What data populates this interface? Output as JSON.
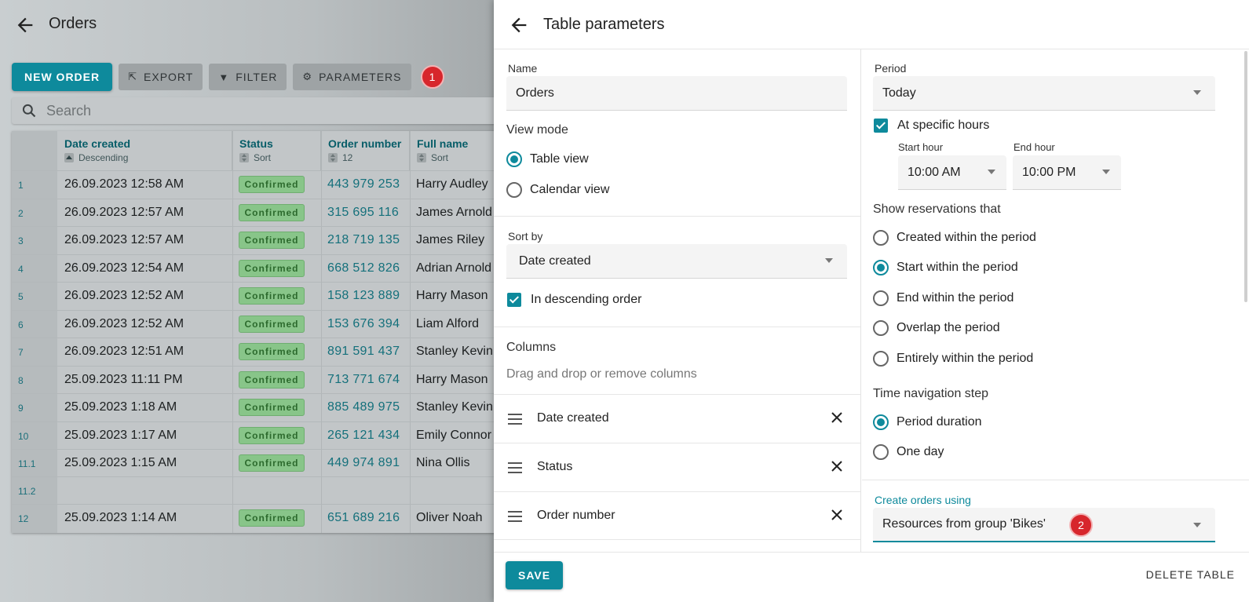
{
  "background": {
    "title": "Orders",
    "toolbar": {
      "new_order": "NEW ORDER",
      "export": "EXPORT",
      "filter": "FILTER",
      "parameters": "PARAMETERS",
      "badge": "1"
    },
    "search_placeholder": "Search",
    "table": {
      "headers": [
        {
          "label": "Date created",
          "sub": "Descending"
        },
        {
          "label": "Status",
          "sub": "Sort"
        },
        {
          "label": "Order number",
          "sub": "12"
        },
        {
          "label": "Full name",
          "sub": "Sort"
        }
      ],
      "rows": [
        {
          "idx": "1",
          "date": "26.09.2023 12:58 AM",
          "status": "Confirmed",
          "number": "443 979 253",
          "name": "Harry Audley"
        },
        {
          "idx": "2",
          "date": "26.09.2023 12:57 AM",
          "status": "Confirmed",
          "number": "315 695 116",
          "name": "James Arnold"
        },
        {
          "idx": "3",
          "date": "26.09.2023 12:57 AM",
          "status": "Confirmed",
          "number": "218 719 135",
          "name": "James Riley"
        },
        {
          "idx": "4",
          "date": "26.09.2023 12:54 AM",
          "status": "Confirmed",
          "number": "668 512 826",
          "name": "Adrian Arnold"
        },
        {
          "idx": "5",
          "date": "26.09.2023 12:52 AM",
          "status": "Confirmed",
          "number": "158 123 889",
          "name": "Harry Mason"
        },
        {
          "idx": "6",
          "date": "26.09.2023 12:52 AM",
          "status": "Confirmed",
          "number": "153 676 394",
          "name": "Liam Alford"
        },
        {
          "idx": "7",
          "date": "26.09.2023 12:51 AM",
          "status": "Confirmed",
          "number": "891 591 437",
          "name": "Stanley Kevin"
        },
        {
          "idx": "8",
          "date": "25.09.2023 11:11 PM",
          "status": "Confirmed",
          "number": "713 771 674",
          "name": "Harry Mason"
        },
        {
          "idx": "9",
          "date": "25.09.2023 1:18 AM",
          "status": "Confirmed",
          "number": "885 489 975",
          "name": "Stanley Kevin"
        },
        {
          "idx": "10",
          "date": "25.09.2023 1:17 AM",
          "status": "Confirmed",
          "number": "265 121 434",
          "name": "Emily Connor"
        },
        {
          "idx": "11.1",
          "date": "25.09.2023 1:15 AM",
          "status": "Confirmed",
          "number": "449 974 891",
          "name": "Nina Ollis"
        },
        {
          "idx": "11.2",
          "date": "",
          "status": "",
          "number": "",
          "name": ""
        },
        {
          "idx": "12",
          "date": "25.09.2023 1:14 AM",
          "status": "Confirmed",
          "number": "651 689 216",
          "name": "Oliver Noah"
        }
      ]
    }
  },
  "panel": {
    "title": "Table parameters",
    "name_label": "Name",
    "name_value": "Orders",
    "view_mode_title": "View mode",
    "view_modes": [
      "Table view",
      "Calendar view"
    ],
    "sort_by_label": "Sort by",
    "sort_by_value": "Date created",
    "descending_label": "In descending order",
    "columns_title": "Columns",
    "columns_hint": "Drag and drop or remove columns",
    "columns": [
      "Date created",
      "Status",
      "Order number"
    ],
    "period_label": "Period",
    "period_value": "Today",
    "specific_hours_label": "At specific hours",
    "start_hour_label": "Start hour",
    "start_hour_value": "10:00 AM",
    "end_hour_label": "End hour",
    "end_hour_value": "10:00 PM",
    "show_reservations_title": "Show reservations that",
    "reservation_options": [
      "Created within the period",
      "Start within the period",
      "End within the period",
      "Overlap the period",
      "Entirely within the period"
    ],
    "time_step_title": "Time navigation step",
    "time_step_options": [
      "Period duration",
      "One day"
    ],
    "create_orders_label": "Create orders using",
    "create_orders_value": "Resources from group 'Bikes'",
    "badge": "2",
    "save": "SAVE",
    "delete": "DELETE TABLE"
  },
  "colors": {
    "accent": "#0e8a9c",
    "badge": "#d7262c",
    "status_confirmed": "#88c589"
  }
}
